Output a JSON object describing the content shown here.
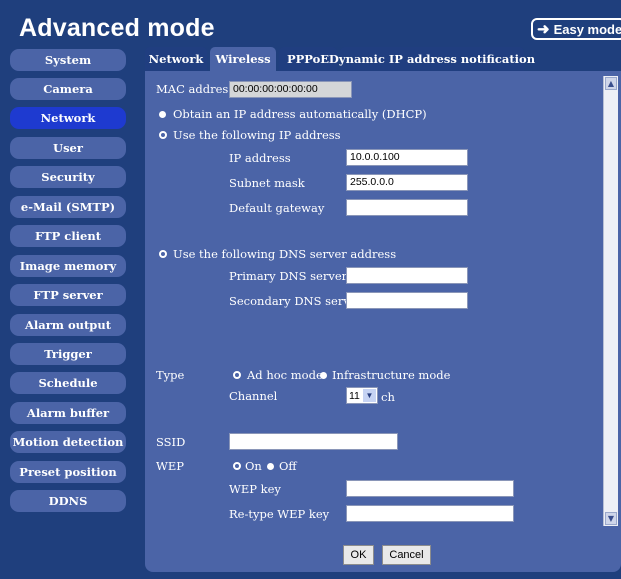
{
  "header": {
    "title": "Advanced mode",
    "easy_mode_label": "Easy mode",
    "easy_mode_icon": "arrow-right-icon"
  },
  "sidebar": {
    "active": "Network",
    "items": [
      {
        "label": "System"
      },
      {
        "label": "Camera"
      },
      {
        "label": "Network"
      },
      {
        "label": "User"
      },
      {
        "label": "Security"
      },
      {
        "label": "e-Mail (SMTP)"
      },
      {
        "label": "FTP client"
      },
      {
        "label": "Image memory"
      },
      {
        "label": "FTP server"
      },
      {
        "label": "Alarm output"
      },
      {
        "label": "Trigger"
      },
      {
        "label": "Schedule"
      },
      {
        "label": "Alarm buffer"
      },
      {
        "label": "Motion detection"
      },
      {
        "label": "Preset position"
      },
      {
        "label": "DDNS"
      }
    ]
  },
  "tabs": {
    "active": "Wireless",
    "items": [
      {
        "label": "Network"
      },
      {
        "label": "Wireless"
      },
      {
        "label": "PPPoE"
      },
      {
        "label": "Dynamic IP address notification"
      }
    ]
  },
  "form": {
    "mac_label": "MAC address",
    "mac_value": "00:00:00:00:00:00",
    "dhcp_label": "Obtain an IP address automatically (DHCP)",
    "static_label": "Use the following IP address",
    "ip_label": "IP address",
    "ip_value": "10.0.0.100",
    "subnet_label": "Subnet mask",
    "subnet_value": "255.0.0.0",
    "gateway_label": "Default gateway",
    "gateway_value": "",
    "dns_label": "Use the following DNS server address",
    "primary_dns_label": "Primary DNS server",
    "primary_dns_value": "",
    "secondary_dns_label": "Secondary DNS server",
    "secondary_dns_value": "",
    "type_label": "Type",
    "adhoc_label": "Ad hoc mode",
    "infra_label": "Infrastructure mode",
    "channel_label": "Channel",
    "channel_value": "11",
    "channel_unit": "ch",
    "ssid_label": "SSID",
    "ssid_value": "",
    "wep_label": "WEP",
    "wep_on_label": "On",
    "wep_off_label": "Off",
    "wep_key_label": "WEP key",
    "wep_key_value": "",
    "retype_wep_label": "Re-type WEP key",
    "retype_wep_value": "",
    "ok_label": "OK",
    "cancel_label": "Cancel"
  },
  "colors": {
    "background": "#1f3f7d",
    "panel": "#4b64a7",
    "active_item": "#1e3ad0",
    "text": "#ffffff"
  }
}
